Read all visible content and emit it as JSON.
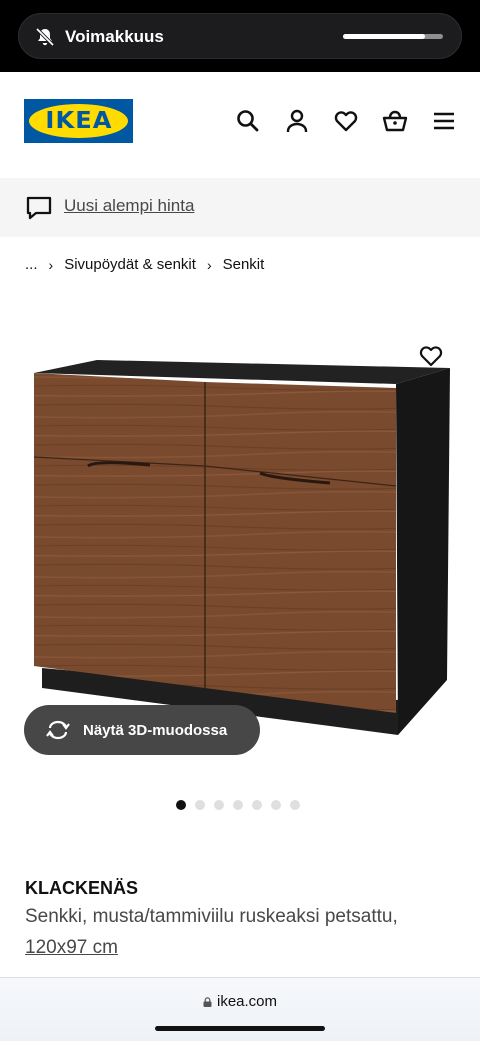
{
  "status": {
    "volume_label": "Voimakkuus",
    "volume_level": 0.82
  },
  "header": {
    "logo_text": "IKEA",
    "icons": [
      "search-icon",
      "account-icon",
      "favourites-icon",
      "shopping-bag-icon",
      "menu-icon"
    ]
  },
  "banner": {
    "link": "Uusi alempi hinta"
  },
  "breadcrumb": {
    "items": [
      "...",
      "Sivupöydät & senkit",
      "Senkit"
    ]
  },
  "gallery": {
    "view_3d_label": "Näytä 3D-muodossa",
    "total_images": 7,
    "active_index": 0
  },
  "product": {
    "name": "KLACKENÄS",
    "description": "Senkki, musta/tammiviilu ruskeaksi petsattu,",
    "dimensions": "120x97 cm"
  },
  "browser": {
    "url": "ikea.com"
  },
  "colors": {
    "ikea_blue": "#0058a3",
    "ikea_yellow": "#ffdb00",
    "wood": "#7b4c31",
    "cabinet_black": "#1b1b1b"
  }
}
